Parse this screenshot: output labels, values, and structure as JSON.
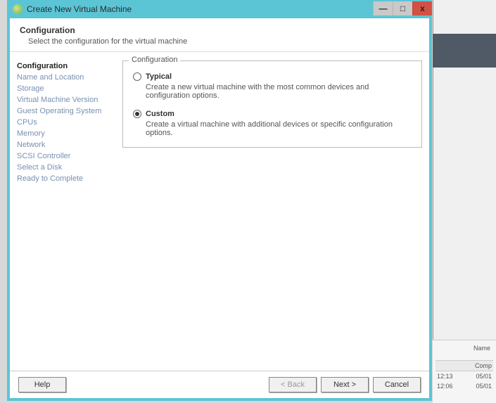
{
  "window": {
    "title": "Create New Virtual Machine"
  },
  "header": {
    "title": "Configuration",
    "subtitle": "Select the configuration for the virtual machine"
  },
  "sidebar": {
    "items": [
      {
        "label": "Configuration",
        "active": true
      },
      {
        "label": "Name and Location",
        "active": false
      },
      {
        "label": "Storage",
        "active": false
      },
      {
        "label": "Virtual Machine Version",
        "active": false
      },
      {
        "label": "Guest Operating System",
        "active": false
      },
      {
        "label": "CPUs",
        "active": false
      },
      {
        "label": "Memory",
        "active": false
      },
      {
        "label": "Network",
        "active": false
      },
      {
        "label": "SCSI Controller",
        "active": false
      },
      {
        "label": "Select a Disk",
        "active": false
      },
      {
        "label": "Ready to Complete",
        "active": false
      }
    ]
  },
  "config_group": {
    "legend": "Configuration",
    "typical": {
      "label": "Typical",
      "desc": "Create a new virtual machine with the most common devices and configuration options.",
      "selected": false
    },
    "custom": {
      "label": "Custom",
      "desc": "Create a virtual machine with additional devices or specific configuration options.",
      "selected": true
    }
  },
  "footer": {
    "help": "Help",
    "back": "< Back",
    "next": "Next >",
    "cancel": "Cancel"
  },
  "background": {
    "name_label": "Name",
    "col_header": "Comp",
    "rows": [
      {
        "time": "12:13",
        "date": "05/01"
      },
      {
        "time": "12:06",
        "date": "05/01"
      }
    ]
  }
}
